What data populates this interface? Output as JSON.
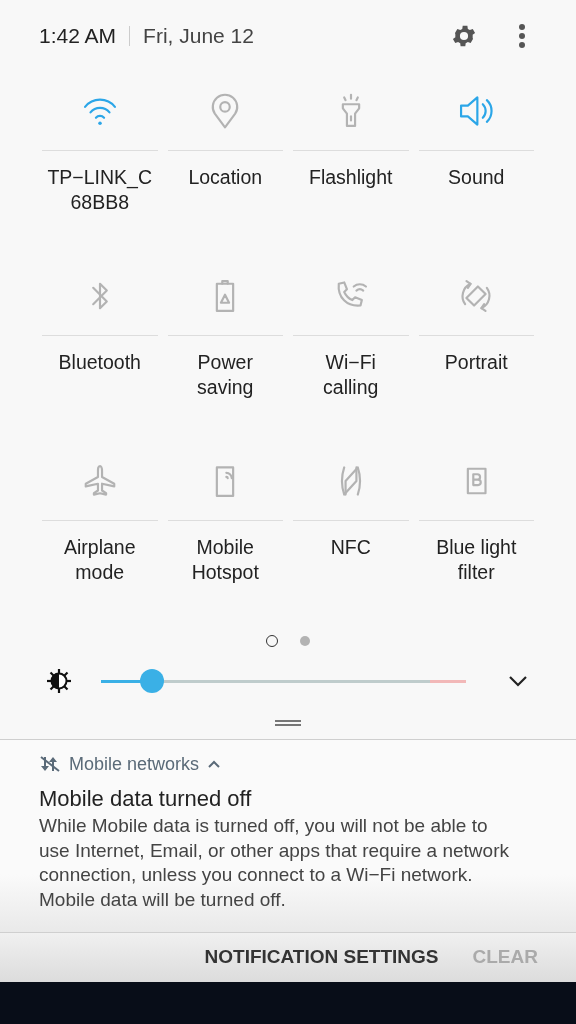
{
  "header": {
    "time": "1:42 AM",
    "date": "Fri, June 12"
  },
  "tiles": [
    {
      "label": "TP−LINK_C\n68BB8",
      "on": true
    },
    {
      "label": "Location",
      "on": false
    },
    {
      "label": "Flashlight",
      "on": false
    },
    {
      "label": "Sound",
      "on": true
    },
    {
      "label": "Bluetooth",
      "on": false
    },
    {
      "label": "Power\nsaving",
      "on": false
    },
    {
      "label": "Wi−Fi\ncalling",
      "on": false
    },
    {
      "label": "Portrait",
      "on": false
    },
    {
      "label": "Airplane\nmode",
      "on": false
    },
    {
      "label": "Mobile\nHotspot",
      "on": false
    },
    {
      "label": "NFC",
      "on": false
    },
    {
      "label": "Blue light\nfilter",
      "on": false
    }
  ],
  "pages": [
    {
      "selected": true
    },
    {
      "selected": false
    }
  ],
  "brightness": {
    "level": 0.14
  },
  "notification": {
    "app": "Mobile networks",
    "title": "Mobile data turned off",
    "body": "While Mobile data is turned off, you will not be able to use Internet, Email, or other apps that require a network connection, unless you connect to a Wi−Fi network. Mobile data will be turned off."
  },
  "footer": {
    "buttons": [
      {
        "label": "NOTIFICATION SETTINGS",
        "disabled": false
      },
      {
        "label": "CLEAR",
        "disabled": true
      }
    ]
  }
}
